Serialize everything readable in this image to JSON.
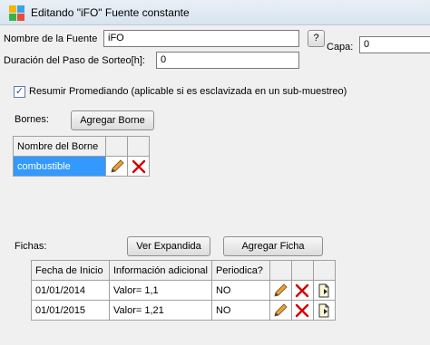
{
  "window": {
    "title": "Editando \"iFO\" Fuente constante",
    "icon": "app-grid-icon"
  },
  "form": {
    "nombre_label": "Nombre de la Fuente",
    "nombre_value": "iFO",
    "help_button": "?",
    "capa_label": "Capa:",
    "capa_value": "0",
    "duracion_label": "Duración del Paso de Sorteo[h]:",
    "duracion_value": "0",
    "resumir_checked": true,
    "resumir_label": "Resumir Promediando (aplicable si es esclavizada en un sub-muestreo)"
  },
  "bornes": {
    "label": "Bornes:",
    "add_button": "Agregar Borne",
    "header": "Nombre del Borne",
    "rows": [
      {
        "name": "combustible",
        "selected": true
      }
    ]
  },
  "fichas": {
    "label": "Fichas:",
    "expand_button": "Ver Expandida",
    "add_button": "Agregar Ficha",
    "columns": [
      "Fecha de Inicio",
      "Información adicional",
      "Periodica?"
    ],
    "rows": [
      {
        "fecha": "01/01/2014",
        "info": "Valor= 1,1",
        "periodica": "NO"
      },
      {
        "fecha": "01/01/2015",
        "info": "Valor= 1,21",
        "periodica": "NO"
      }
    ]
  },
  "icons": {
    "edit": "pencil-icon",
    "delete": "red-x-icon",
    "view": "document-icon"
  },
  "colors": {
    "selection": "#3399ff",
    "delete_red": "#d40000",
    "pencil_orange": "#e8a13a"
  }
}
